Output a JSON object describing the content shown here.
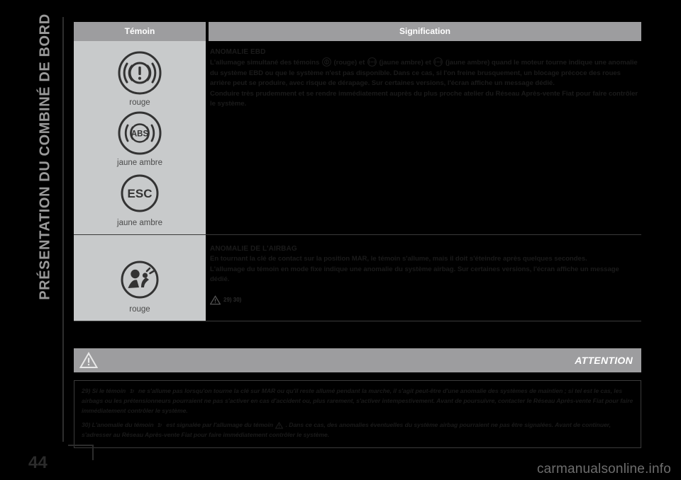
{
  "chapter": {
    "title": "PRÉSENTATION DU COMBINÉ DE BORD"
  },
  "page": {
    "number": "44",
    "watermark": "carmanualsonline.info"
  },
  "table": {
    "headers": {
      "temoin": "Témoin",
      "signification": "Signification"
    },
    "rows": [
      {
        "icons": [
          {
            "name": "brake-warning-icon",
            "caption": "rouge"
          },
          {
            "name": "abs-warning-icon",
            "caption": "jaune ambre"
          },
          {
            "name": "esc-warning-icon",
            "caption": "jaune ambre"
          }
        ],
        "title": "ANOMALIE EBD",
        "paragraphs": [
          "L'allumage simultané des témoins  (rouge) et  (jaune ambre) et  (jaune ambre) quand le moteur tourne indique une anomalie du système EBD ou que le système n'est pas disponible. Dans ce cas, si l'on freine brusquement, un blocage précoce des roues arrière peut se produire, avec risque de dérapage. Sur certaines versions, l'écran affiche un message dédié.",
          "Conduire très prudemment et se rendre immédiatement auprès du plus proche atelier du Réseau Après-vente Fiat pour faire contrôler le système."
        ]
      },
      {
        "icons": [
          {
            "name": "airbag-warning-icon",
            "caption": "rouge"
          }
        ],
        "title": "ANOMALIE DE L'AIRBAG",
        "paragraphs": [
          "En tournant la clé de contact sur la position MAR, le témoin s'allume, mais il doit s'éteindre après quelques secondes.",
          "L'allumage du témoin en mode fixe indique une anomalie du système airbag. Sur certaines versions, l'écran affiche un message dédié."
        ],
        "reference": "29) 30)"
      }
    ]
  },
  "attention": {
    "label": "ATTENTION",
    "notes": [
      "29) Si le témoin  ne s'allume pas lorsqu'on tourne la clé sur MAR ou qu'il reste allumé pendant la marche, il s'agit peut-être d'une anomalie des systèmes de maintien ; si tel est le cas, les airbags ou les prétensionneurs pourraient ne pas s'activer en cas d'accident ou, plus rarement, s'activer intempestivement. Avant de poursuivre, contacter le Réseau Après-vente Fiat pour faire immédiatement contrôler le système.",
      "30) L'anomalie du témoin  est signalée par l'allumage du témoin  . Dans ce cas, des anomalies éventuelles du système airbag pourraient ne pas être signalées. Avant de continuer, s'adresser au Réseau Après-vente Fiat pour faire immédiatement contrôler le système."
    ]
  }
}
